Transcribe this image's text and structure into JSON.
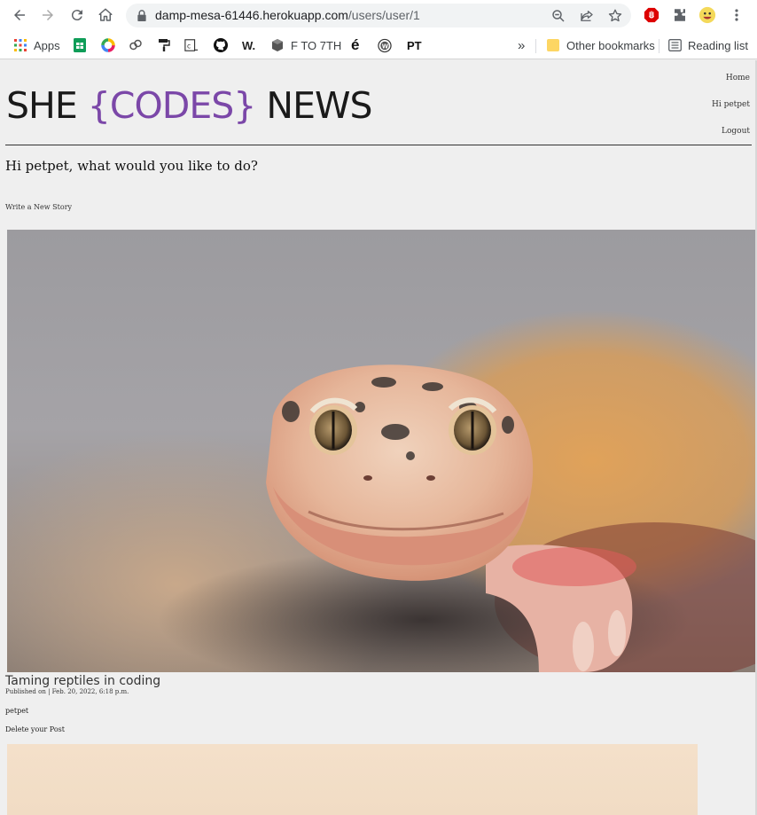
{
  "browser": {
    "url_host": "damp-mesa-61446.herokuapp.com",
    "url_path": "/users/user/1",
    "bookmarks": [
      {
        "label": "Apps",
        "icon": "apps-grid-icon"
      },
      {
        "label": "",
        "icon": "sheets-icon"
      },
      {
        "label": "",
        "icon": "color-wheel-icon"
      },
      {
        "label": "",
        "icon": "link-icon"
      },
      {
        "label": "",
        "icon": "paint-roller-icon"
      },
      {
        "label": "",
        "icon": "codepen-icon"
      },
      {
        "label": "",
        "icon": "github-icon"
      },
      {
        "label": "W.",
        "icon": ""
      },
      {
        "label": "F TO 7TH",
        "icon": "cube-icon"
      },
      {
        "label": "é",
        "icon": ""
      },
      {
        "label": "",
        "icon": "wordpress-icon"
      },
      {
        "label": "PT",
        "icon": ""
      }
    ],
    "overflow_label": "»",
    "other_bookmarks": "Other bookmarks",
    "reading_list": "Reading list"
  },
  "site": {
    "title_part1": "SHE ",
    "title_codes": "{CODES}",
    "title_part2": " NEWS",
    "nav": {
      "home": "Home",
      "user": "Hi petpet",
      "logout": "Logout"
    },
    "greeting": "Hi petpet, what would you like to do?",
    "write_link": "Write a New Story"
  },
  "post": {
    "title": "Taming reptiles in coding",
    "meta": "Published on | Feb. 20, 2022, 6:18 p.m.",
    "author": "petpet",
    "delete_label": "Delete your Post"
  },
  "colors": {
    "accent": "#7b47a8",
    "background": "#efefef"
  }
}
